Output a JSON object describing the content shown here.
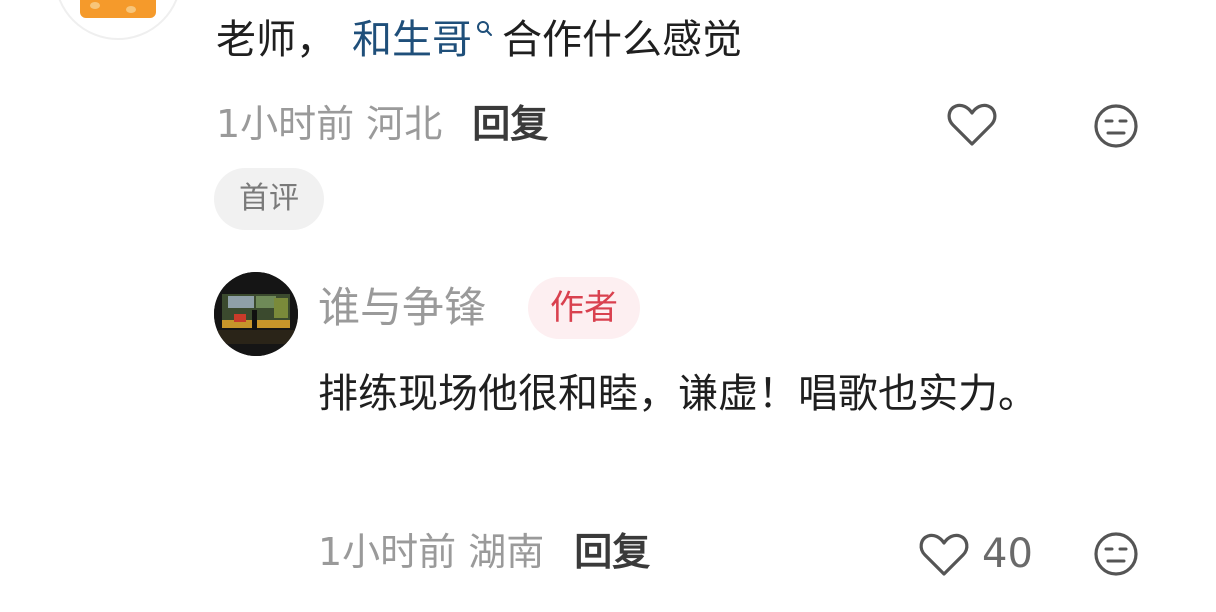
{
  "top_comment": {
    "text_before": "老师，",
    "mention": "和生哥",
    "text_after": "合作什么感觉",
    "time": "1小时前",
    "location": "河北",
    "reply_label": "回复",
    "badge": "首评"
  },
  "reply_comment": {
    "username": "谁与争锋",
    "author_badge": "作者",
    "text": "排练现场他很和睦，谦虚！唱歌也实力。",
    "time": "1小时前",
    "location": "湖南",
    "reply_label": "回复",
    "like_count": "40"
  },
  "icons": [
    "heart-outline-icon",
    "neutral-face-icon",
    "search-icon"
  ],
  "colors": {
    "mention": "#1f4f7a",
    "author_badge_text": "#d9414f",
    "author_badge_bg": "#fdeff1",
    "meta_gray": "#9a9a9a",
    "cheese_orange": "#f59a2b"
  }
}
